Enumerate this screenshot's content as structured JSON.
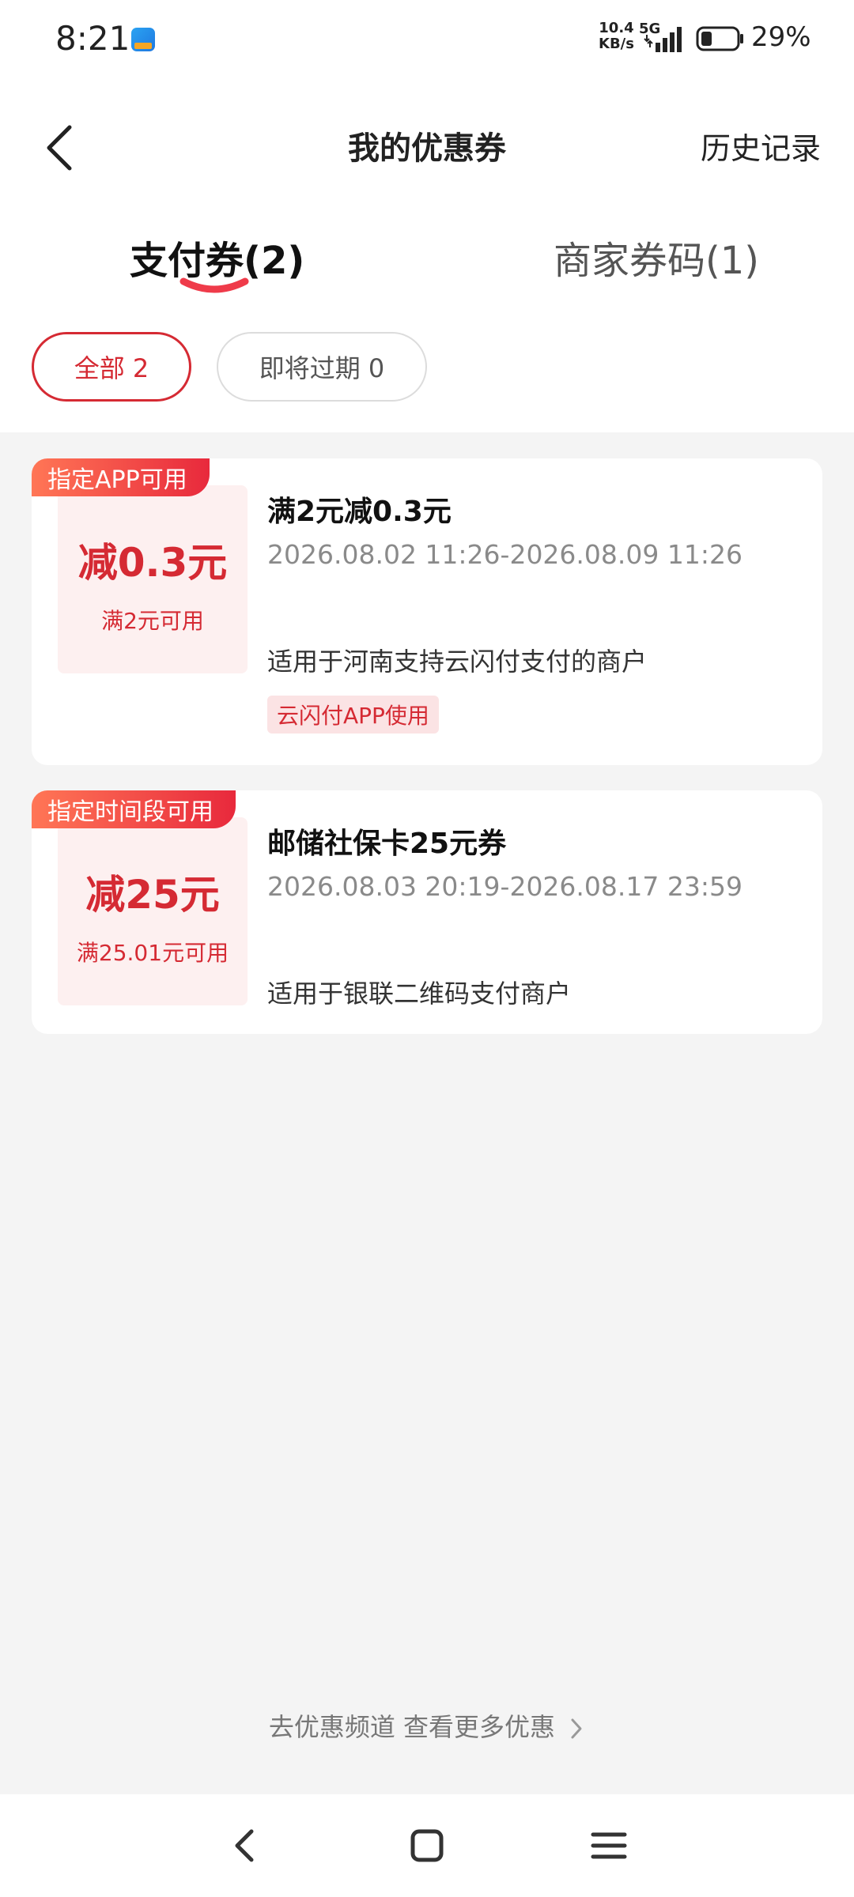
{
  "status_bar": {
    "time": "8:21",
    "app_icon": "unionpay-app-icon",
    "net_speed_value": "10.4",
    "net_speed_unit": "KB/s",
    "network": "5G",
    "battery_percent": "29%",
    "battery_level": 0.29
  },
  "header": {
    "back_icon": "back-arrow-icon",
    "title": "我的优惠券",
    "history_label": "历史记录"
  },
  "tabs": [
    {
      "label": "支付券(2)",
      "active": true
    },
    {
      "label": "商家券码(1)",
      "active": false
    }
  ],
  "filters": [
    {
      "label": "全部 2",
      "active": true
    },
    {
      "label": "即将过期 0",
      "active": false
    }
  ],
  "coupons": [
    {
      "tag": "指定APP可用",
      "amount": "减0.3元",
      "condition": "满2元可用",
      "title": "满2元减0.3元",
      "validity": "2026.08.02 11:26-2026.08.09 11:26",
      "scope": "适用于河南支持云闪付支付的商户",
      "chip": "云闪付APP使用"
    },
    {
      "tag": "指定时间段可用",
      "amount": "减25元",
      "condition": "满25.01元可用",
      "title": "邮储社保卡25元券",
      "validity": "2026.08.03 20:19-2026.08.17 23:59",
      "scope": "适用于银联二维码支付商户"
    }
  ],
  "footer_link": "去优惠频道 查看更多优惠",
  "colors": {
    "accent": "#d52a33",
    "tag_gradient_start": "#ff7656",
    "tag_gradient_end": "#e8293c",
    "background": "#f4f4f4"
  },
  "nav_bar": [
    "nav-back-icon",
    "nav-home-icon",
    "nav-menu-icon"
  ]
}
